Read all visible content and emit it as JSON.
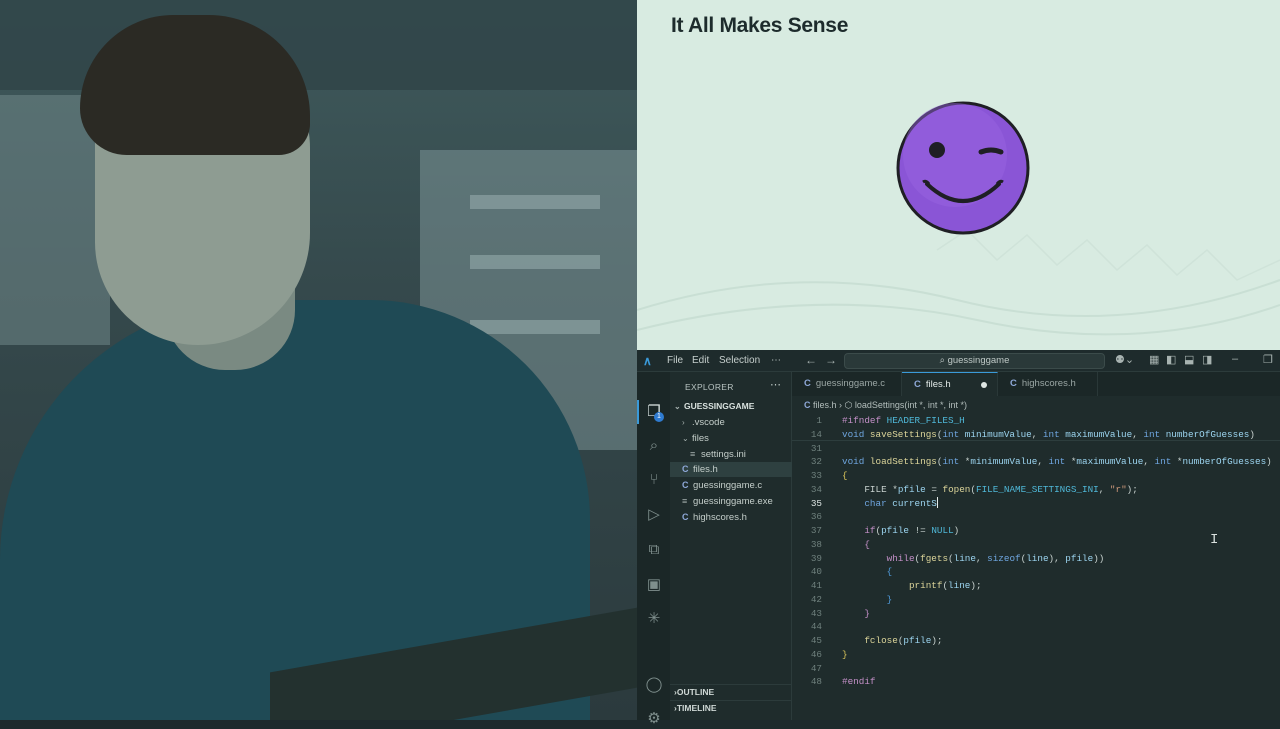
{
  "slide": {
    "title": "It All Makes Sense",
    "emoji": "winking-face"
  },
  "titlebar": {
    "menu": [
      "File",
      "Edit",
      "Selection",
      "⋯"
    ],
    "search": "⌕ guessinggame"
  },
  "activity": {
    "explorer_badge": "1"
  },
  "explorer": {
    "header": "EXPLORER",
    "more": "⋯",
    "root": "GUESSINGGAME",
    "items": [
      {
        "label": ".vscode",
        "type": "folder",
        "chev": "›",
        "indent": 1
      },
      {
        "label": "files",
        "type": "folder",
        "chev": "⌄",
        "indent": 1
      },
      {
        "label": "settings.ini",
        "type": "ini",
        "chev": "",
        "indent": 2
      },
      {
        "label": "files.h",
        "type": "c",
        "chev": "",
        "indent": 1,
        "selected": true
      },
      {
        "label": "guessinggame.c",
        "type": "c",
        "chev": "",
        "indent": 1
      },
      {
        "label": "guessinggame.exe",
        "type": "ini",
        "chev": "",
        "indent": 1
      },
      {
        "label": "highscores.h",
        "type": "c",
        "chev": "",
        "indent": 1
      }
    ],
    "outline": "OUTLINE",
    "timeline": "TIMELINE"
  },
  "tabs": [
    {
      "label": "guessinggame.c",
      "active": false
    },
    {
      "label": "files.h",
      "active": true,
      "dirty": true
    },
    {
      "label": "highscores.h",
      "active": false
    }
  ],
  "breadcrumb": {
    "file": "files.h",
    "symbol": "loadSettings(int *, int *, int *)"
  },
  "code": [
    {
      "n": "1",
      "t": [
        [
          "pp",
          "#ifndef "
        ],
        [
          "mac",
          "HEADER_FILES_H"
        ]
      ]
    },
    {
      "n": "14",
      "t": [
        [
          "kw",
          "void "
        ],
        [
          "fn",
          "saveSettings"
        ],
        [
          "",
          "("
        ],
        [
          "kw",
          "int "
        ],
        [
          "var",
          "minimumValue"
        ],
        [
          "",
          ", "
        ],
        [
          "kw",
          "int "
        ],
        [
          "var",
          "maximumValue"
        ],
        [
          "",
          ", "
        ],
        [
          "kw",
          "int "
        ],
        [
          "var",
          "numberOfGuesses"
        ],
        [
          "",
          ")"
        ]
      ]
    },
    {
      "n": "31",
      "t": []
    },
    {
      "n": "32",
      "t": [
        [
          "kw",
          "void "
        ],
        [
          "fn",
          "loadSettings"
        ],
        [
          "",
          "("
        ],
        [
          "kw",
          "int "
        ],
        [
          "",
          "*"
        ],
        [
          "var",
          "minimumValue"
        ],
        [
          "",
          ", "
        ],
        [
          "kw",
          "int "
        ],
        [
          "",
          "*"
        ],
        [
          "var",
          "maximumValue"
        ],
        [
          "",
          ", "
        ],
        [
          "kw",
          "int "
        ],
        [
          "",
          "*"
        ],
        [
          "var",
          "numberOfGuesses"
        ],
        [
          "",
          ")"
        ]
      ]
    },
    {
      "n": "33",
      "t": [
        [
          "brace",
          "{"
        ]
      ]
    },
    {
      "n": "34",
      "t": [
        [
          "",
          "    "
        ],
        [
          "",
          "FILE "
        ],
        [
          "",
          "*"
        ],
        [
          "var",
          "pfile"
        ],
        [
          "",
          " = "
        ],
        [
          "fn",
          "fopen"
        ],
        [
          "",
          "("
        ],
        [
          "mac",
          "FILE_NAME_SETTINGS_INI"
        ],
        [
          "",
          ", "
        ],
        [
          "str",
          "\"r\""
        ],
        [
          "",
          ");"
        ]
      ]
    },
    {
      "n": "35",
      "t": [
        [
          "",
          "    "
        ],
        [
          "kw",
          "char "
        ],
        [
          "var",
          "currentS"
        ]
      ],
      "current": true
    },
    {
      "n": "36",
      "t": []
    },
    {
      "n": "37",
      "t": [
        [
          "",
          "    "
        ],
        [
          "kw2",
          "if"
        ],
        [
          "",
          "("
        ],
        [
          "var",
          "pfile"
        ],
        [
          "",
          " != "
        ],
        [
          "mac",
          "NULL"
        ],
        [
          "",
          ")"
        ]
      ]
    },
    {
      "n": "38",
      "t": [
        [
          "",
          "    "
        ],
        [
          "brace2",
          "{"
        ]
      ]
    },
    {
      "n": "39",
      "t": [
        [
          "",
          "        "
        ],
        [
          "kw2",
          "while"
        ],
        [
          "",
          "("
        ],
        [
          "fn",
          "fgets"
        ],
        [
          "",
          "("
        ],
        [
          "var",
          "line"
        ],
        [
          "",
          ", "
        ],
        [
          "kw",
          "sizeof"
        ],
        [
          "",
          "("
        ],
        [
          "var",
          "line"
        ],
        [
          "",
          "), "
        ],
        [
          "var",
          "pfile"
        ],
        [
          "",
          "))"
        ]
      ]
    },
    {
      "n": "40",
      "t": [
        [
          "",
          "        "
        ],
        [
          "brace3",
          "{"
        ]
      ]
    },
    {
      "n": "41",
      "t": [
        [
          "",
          "            "
        ],
        [
          "fn",
          "printf"
        ],
        [
          "",
          "("
        ],
        [
          "var",
          "line"
        ],
        [
          "",
          ");"
        ]
      ]
    },
    {
      "n": "42",
      "t": [
        [
          "",
          "        "
        ],
        [
          "brace3",
          "}"
        ]
      ]
    },
    {
      "n": "43",
      "t": [
        [
          "",
          "    "
        ],
        [
          "brace2",
          "}"
        ]
      ]
    },
    {
      "n": "44",
      "t": []
    },
    {
      "n": "45",
      "t": [
        [
          "",
          "    "
        ],
        [
          "fn",
          "fclose"
        ],
        [
          "",
          "("
        ],
        [
          "var",
          "pfile"
        ],
        [
          "",
          ");"
        ]
      ]
    },
    {
      "n": "46",
      "t": [
        [
          "brace",
          "}"
        ]
      ]
    },
    {
      "n": "47",
      "t": []
    },
    {
      "n": "48",
      "t": [
        [
          "pp",
          "#endif"
        ]
      ]
    }
  ],
  "cursor_line": "35"
}
